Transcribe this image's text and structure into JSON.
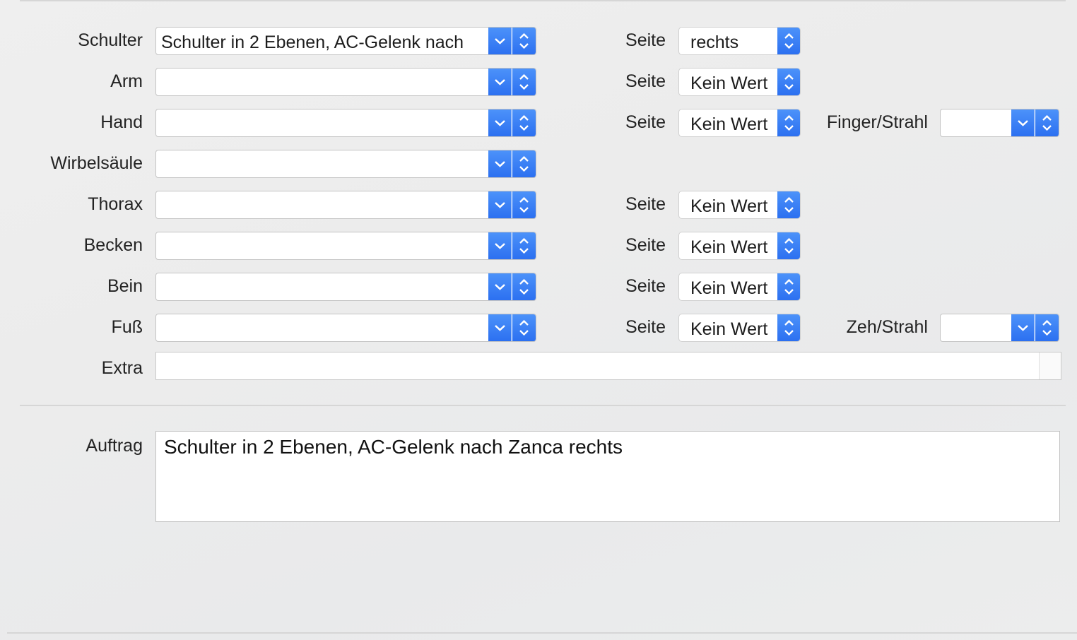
{
  "rows": [
    {
      "label": "Schulter",
      "value": "Schulter in 2 Ebenen, AC-Gelenk nach",
      "side_label": "Seite",
      "side_value": "rechts"
    },
    {
      "label": "Arm",
      "value": "",
      "side_label": "Seite",
      "side_value": "Kein Wert"
    },
    {
      "label": "Hand",
      "value": "",
      "side_label": "Seite",
      "side_value": "Kein Wert",
      "extra_label": "Finger/Strahl",
      "extra_value": ""
    },
    {
      "label": "Wirbelsäule",
      "value": ""
    },
    {
      "label": "Thorax",
      "value": "",
      "side_label": "Seite",
      "side_value": "Kein Wert"
    },
    {
      "label": "Becken",
      "value": "",
      "side_label": "Seite",
      "side_value": "Kein Wert"
    },
    {
      "label": "Bein",
      "value": "",
      "side_label": "Seite",
      "side_value": "Kein Wert"
    },
    {
      "label": "Fuß",
      "value": "",
      "side_label": "Seite",
      "side_value": "Kein Wert",
      "extra_label": "Zeh/Strahl",
      "extra_value": ""
    }
  ],
  "extra": {
    "label": "Extra",
    "value": ""
  },
  "auftrag": {
    "label": "Auftrag",
    "value": "Schulter in 2 Ebenen, AC-Gelenk nach Zanca rechts"
  }
}
